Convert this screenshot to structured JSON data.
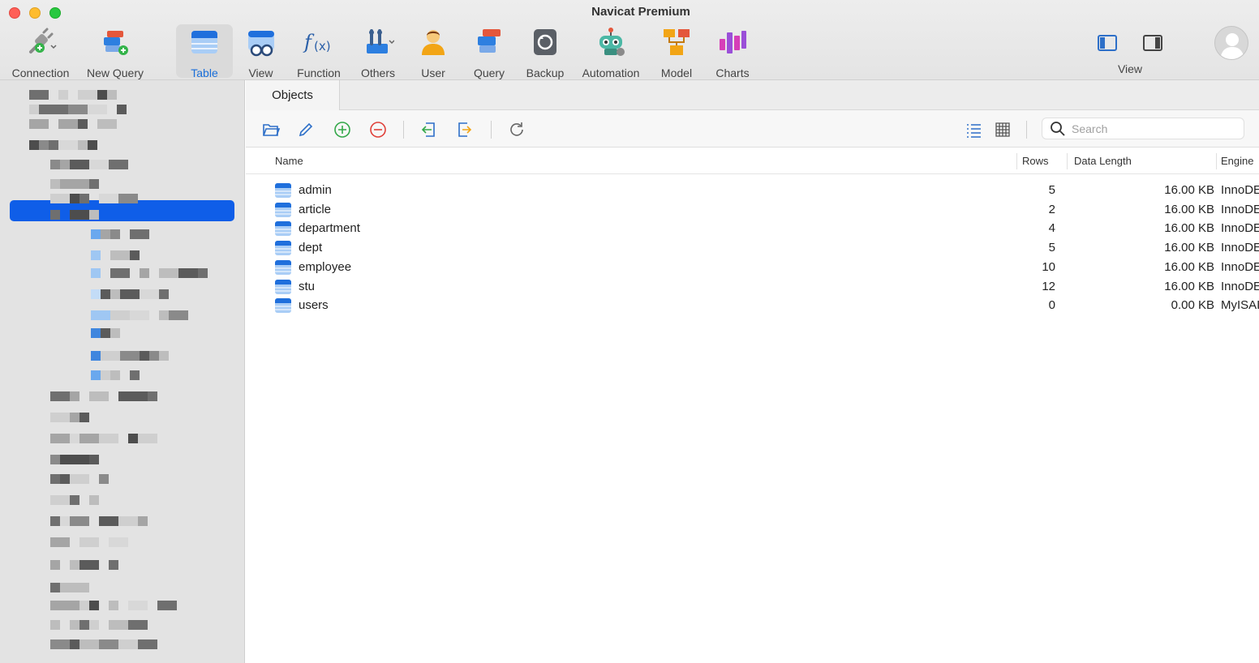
{
  "window": {
    "title": "Navicat Premium"
  },
  "toolbar": {
    "buttons": [
      {
        "label": "Connection",
        "icon": "connection-plug-icon"
      },
      {
        "label": "New Query",
        "icon": "new-query-icon"
      },
      {
        "label": "Table",
        "icon": "table-icon",
        "active": true
      },
      {
        "label": "View",
        "icon": "view-glasses-icon"
      },
      {
        "label": "Function",
        "icon": "function-fx-icon"
      },
      {
        "label": "Others",
        "icon": "others-tools-icon"
      },
      {
        "label": "User",
        "icon": "user-icon"
      },
      {
        "label": "Query",
        "icon": "query-icon"
      },
      {
        "label": "Backup",
        "icon": "backup-icon"
      },
      {
        "label": "Automation",
        "icon": "automation-robot-icon"
      },
      {
        "label": "Model",
        "icon": "model-icon"
      },
      {
        "label": "Charts",
        "icon": "charts-icon"
      }
    ],
    "view_label": "View"
  },
  "tabs": [
    {
      "label": "Objects"
    }
  ],
  "search": {
    "placeholder": "Search"
  },
  "table": {
    "columns": {
      "name": "Name",
      "rows": "Rows",
      "data_length": "Data Length",
      "engine": "Engine"
    },
    "rows": [
      {
        "name": "admin",
        "rows": "5",
        "data_length": "16.00 KB",
        "engine": "InnoDE"
      },
      {
        "name": "article",
        "rows": "2",
        "data_length": "16.00 KB",
        "engine": "InnoDE"
      },
      {
        "name": "department",
        "rows": "4",
        "data_length": "16.00 KB",
        "engine": "InnoDE"
      },
      {
        "name": "dept",
        "rows": "5",
        "data_length": "16.00 KB",
        "engine": "InnoDE"
      },
      {
        "name": "employee",
        "rows": "10",
        "data_length": "16.00 KB",
        "engine": "InnoDE"
      },
      {
        "name": "stu",
        "rows": "12",
        "data_length": "16.00 KB",
        "engine": "InnoDE"
      },
      {
        "name": "users",
        "rows": "0",
        "data_length": "0.00 KB",
        "engine": "MyISAI"
      }
    ]
  },
  "colors": {
    "accent": "#1a6fd9",
    "selection": "#0f5ee8",
    "sidebar_bg": "#e3e3e3"
  }
}
